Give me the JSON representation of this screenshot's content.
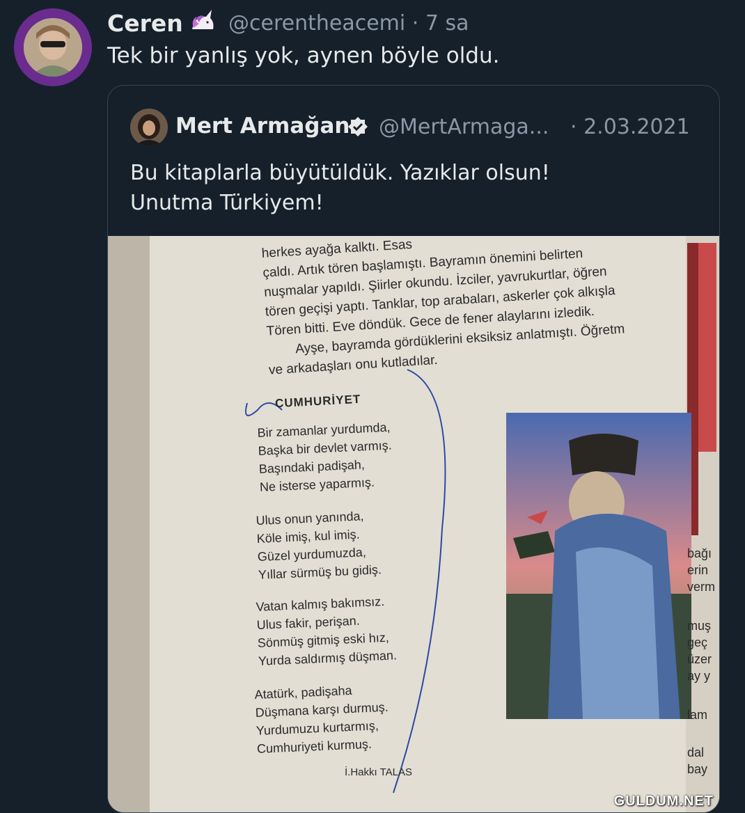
{
  "tweet": {
    "author_name": "Ceren",
    "emoji": "unicorn-icon",
    "handle_time": "@cerentheacemi · 7 sa",
    "text": "Tek bir yanlış yok, aynen böyle oldu."
  },
  "quoted_tweet": {
    "author_name": "Mert Armağan",
    "verified_icon": "verified-badge-icon",
    "handle": "@MertArmaga...",
    "date": "· 2.03.2021",
    "text_line1": "Bu kitaplarla büyütüldük. Yazıklar olsun!",
    "text_line2": "Unutma Türkiyem!"
  },
  "book_page": {
    "prose": [
      "herkes ayağa kalktı. Esas",
      "çaldı. Artık tören başlamıştı. Bayramın önemini belirten",
      "nuşmalar yapıldı. Şiirler okundu. İzciler, yavrukurtlar, öğren",
      "tören geçişi yaptı. Tanklar, top arabaları, askerler çok alkışla",
      "Tören bitti. Eve döndük. Gece de fener alaylarını izledik.",
      "Ayşe, bayramda gördüklerini eksiksiz anlatmıştı. Öğretm",
      "ve arkadaşları onu kutladılar."
    ],
    "poem_title": "CUMHURİYET",
    "stanzas": [
      [
        "Bir zamanlar yurdumda,",
        "Başka bir devlet varmış.",
        "Başındaki padişah,",
        "Ne isterse yaparmış."
      ],
      [
        "Ulus onun yanında,",
        "Köle imiş, kul imiş.",
        "Güzel yurdumuzda,",
        "Yıllar sürmüş bu gidiş."
      ],
      [
        "Vatan kalmış bakımsız.",
        "Ulus fakir, perişan.",
        "Sönmüş gitmiş eski hız,",
        "Yurda saldırmış düşman."
      ],
      [
        "Atatürk, padişaha",
        "Düşmana karşı durmuş.",
        "Yurdumuzu kurtarmış,",
        "Cumhuriyeti kurmuş."
      ]
    ],
    "poet": "İ.Hakkı TALAS",
    "side_fragments": [
      "bağı",
      "erin",
      "verm",
      "muş",
      "geç",
      "üzer",
      "ay y",
      "lam",
      "dal",
      "bay"
    ]
  },
  "watermark": "GULDUM.NET",
  "colors": {
    "background": "#15202b",
    "muted": "#8b98a5",
    "verified": "#e7e9ea",
    "avatar_ring": "#6a2c8e"
  }
}
